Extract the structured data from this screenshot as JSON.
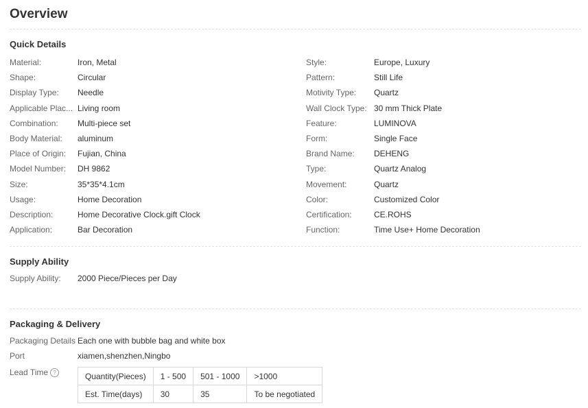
{
  "title": "Overview",
  "quick": {
    "heading": "Quick Details",
    "left": [
      {
        "k": "Material:",
        "v": "Iron, Metal"
      },
      {
        "k": "Shape:",
        "v": "Circular"
      },
      {
        "k": "Display Type:",
        "v": "Needle"
      },
      {
        "k": "Applicable Plac...",
        "v": "Living room"
      },
      {
        "k": "Combination:",
        "v": "Multi-piece set"
      },
      {
        "k": "Body Material:",
        "v": "aluminum"
      },
      {
        "k": "Place of Origin:",
        "v": "Fujian, China"
      },
      {
        "k": "Model Number:",
        "v": "DH 9862"
      },
      {
        "k": "Size:",
        "v": "35*35*4.1cm"
      },
      {
        "k": "Usage:",
        "v": "Home Decoration"
      },
      {
        "k": "Description:",
        "v": "Home Decorative Clock.gift Clock"
      },
      {
        "k": "Application:",
        "v": "Bar Decoration"
      }
    ],
    "right": [
      {
        "k": "Style:",
        "v": "Europe, Luxury"
      },
      {
        "k": "Pattern:",
        "v": "Still Life"
      },
      {
        "k": "Motivity Type:",
        "v": "Quartz"
      },
      {
        "k": "Wall Clock Type:",
        "v": "30 mm Thick Plate"
      },
      {
        "k": "Feature:",
        "v": "LUMINOVA"
      },
      {
        "k": "Form:",
        "v": "Single Face"
      },
      {
        "k": "Brand Name:",
        "v": "DEHENG"
      },
      {
        "k": "Type:",
        "v": "Quartz Analog"
      },
      {
        "k": "Movement:",
        "v": "Quartz"
      },
      {
        "k": "Color:",
        "v": "Customized Color"
      },
      {
        "k": "Certification:",
        "v": "CE.ROHS"
      },
      {
        "k": "Function:",
        "v": "Time Use+ Home Decoration"
      }
    ]
  },
  "supply": {
    "heading": "Supply Ability",
    "k": "Supply Ability:",
    "v": "2000 Piece/Pieces per Day"
  },
  "packaging": {
    "heading": "Packaging & Delivery",
    "details_k": "Packaging Details",
    "details_v": "Each one with bubble bag and white box",
    "port_k": "Port",
    "port_v": "xiamen,shenzhen,Ningbo",
    "lead_k": "Lead Time",
    "lead_icon": "help-icon",
    "lead_table": {
      "row1": [
        "Quantity(Pieces)",
        "1 - 500",
        "501 - 1000",
        ">1000"
      ],
      "row2": [
        "Est. Time(days)",
        "30",
        "35",
        "To be negotiated"
      ]
    }
  }
}
